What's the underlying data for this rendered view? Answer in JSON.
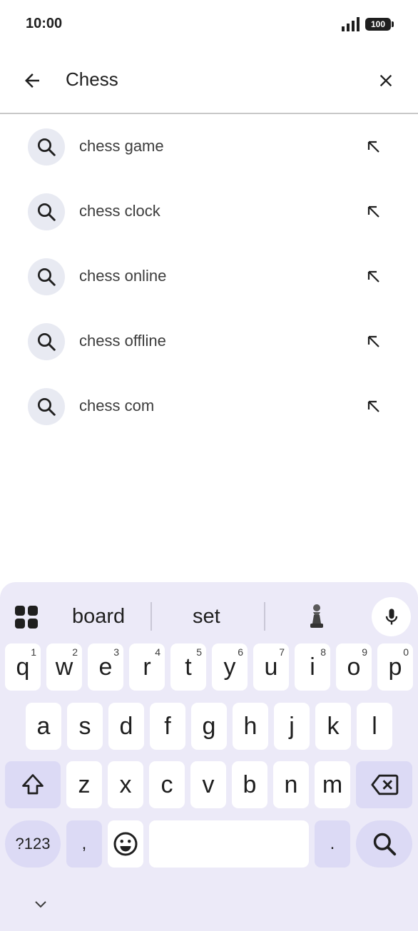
{
  "status_bar": {
    "time": "10:00",
    "battery": "100"
  },
  "search": {
    "query": "Chess"
  },
  "suggestions": [
    {
      "label": "chess game"
    },
    {
      "label": "chess clock"
    },
    {
      "label": "chess online"
    },
    {
      "label": "chess offline"
    },
    {
      "label": "chess com"
    }
  ],
  "keyboard": {
    "predictions": [
      "board",
      "set"
    ],
    "row1": [
      {
        "key": "q",
        "hint": "1"
      },
      {
        "key": "w",
        "hint": "2"
      },
      {
        "key": "e",
        "hint": "3"
      },
      {
        "key": "r",
        "hint": "4"
      },
      {
        "key": "t",
        "hint": "5"
      },
      {
        "key": "y",
        "hint": "6"
      },
      {
        "key": "u",
        "hint": "7"
      },
      {
        "key": "i",
        "hint": "8"
      },
      {
        "key": "o",
        "hint": "9"
      },
      {
        "key": "p",
        "hint": "0"
      }
    ],
    "row2": [
      "a",
      "s",
      "d",
      "f",
      "g",
      "h",
      "j",
      "k",
      "l"
    ],
    "row3": [
      "z",
      "x",
      "c",
      "v",
      "b",
      "n",
      "m"
    ],
    "symbols_label": "?123",
    "comma": ",",
    "period": "."
  },
  "icons": {
    "back": "arrow-left-icon",
    "clear": "close-icon",
    "suggestion": "search-icon",
    "fill": "arrow-up-left-icon",
    "apps": "apps-grid-icon",
    "pawn": "chess-pawn-icon",
    "mic": "microphone-icon",
    "shift": "shift-icon",
    "backspace": "backspace-icon",
    "emoji": "emoji-icon",
    "search_key": "search-icon",
    "collapse": "chevron-down-icon"
  },
  "colors": {
    "keyboard_bg": "#eceaf8",
    "modifier_key": "#dcdaf5",
    "suggestion_icon_bg": "#e8eaf2"
  }
}
